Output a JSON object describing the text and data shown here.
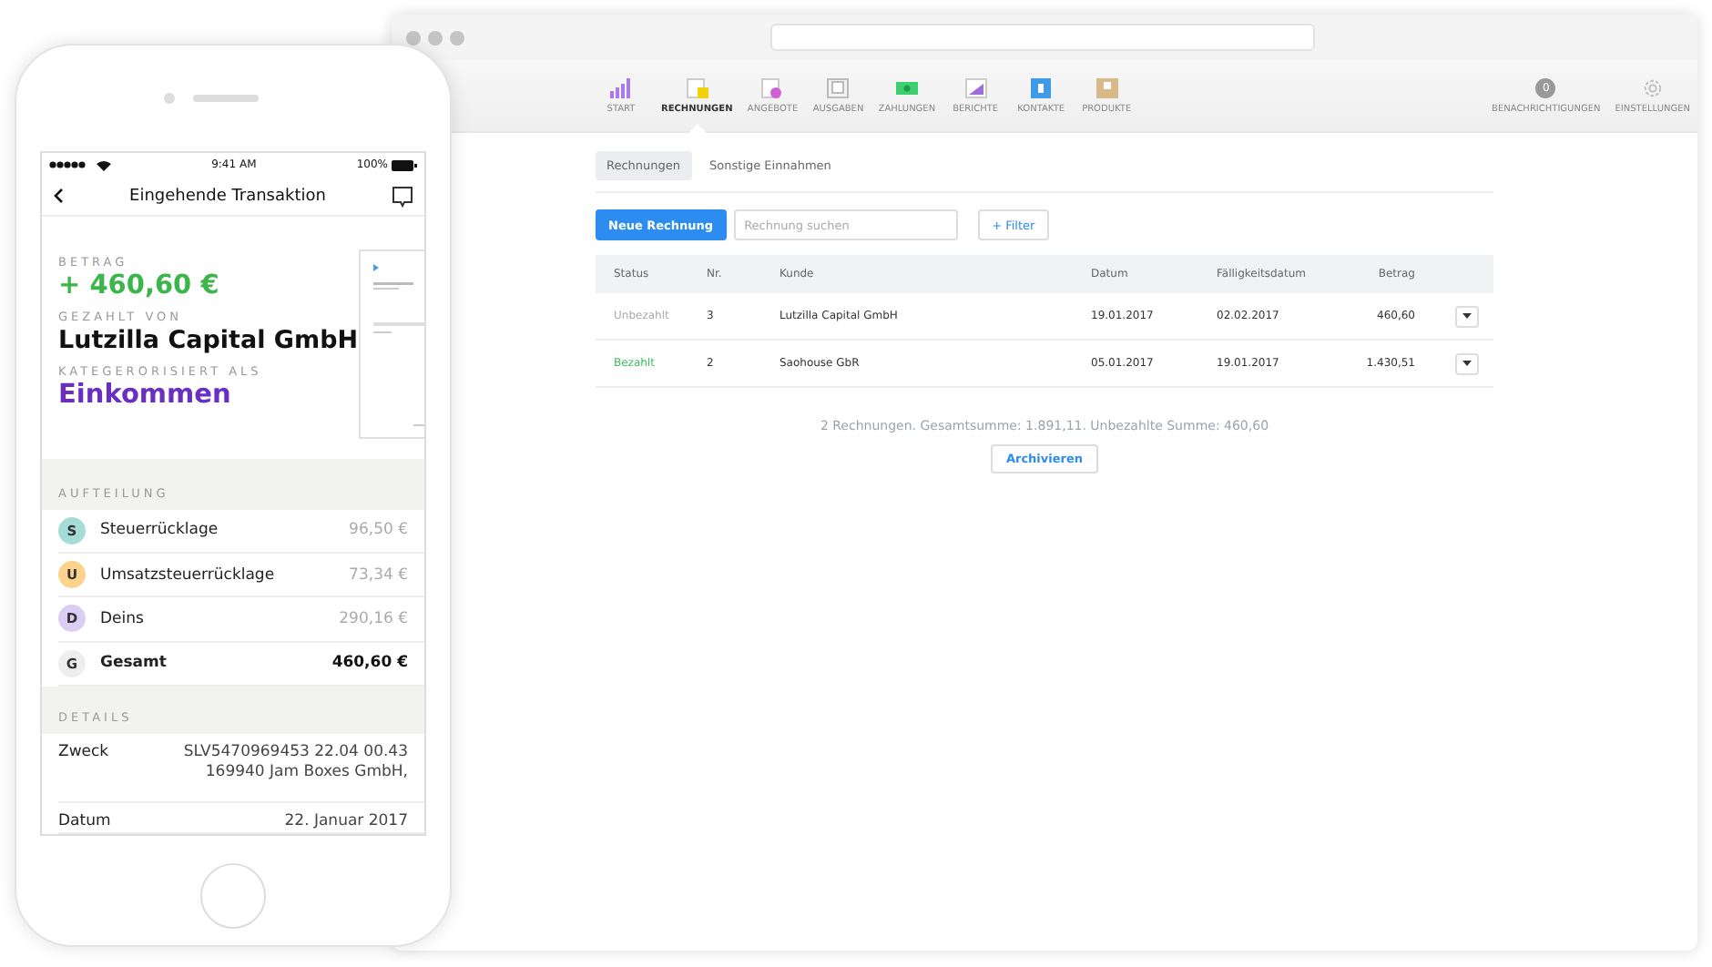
{
  "web_app": {
    "nav": {
      "items": [
        {
          "label": "START",
          "selected": false
        },
        {
          "label": "RECHNUNGEN",
          "selected": true
        },
        {
          "label": "ANGEBOTE",
          "selected": false
        },
        {
          "label": "AUSGABEN",
          "selected": false
        },
        {
          "label": "ZAHLUNGEN",
          "selected": false
        },
        {
          "label": "BERICHTE",
          "selected": false
        },
        {
          "label": "KONTAKTE",
          "selected": false
        },
        {
          "label": "PRODUKTE",
          "selected": false
        }
      ],
      "right_items": [
        {
          "label": "BENACHRICHTIGUNGEN",
          "badge": "0"
        },
        {
          "label": "EINSTELLUNGEN"
        }
      ]
    },
    "subtabs": [
      {
        "label": "Rechnungen",
        "selected": true
      },
      {
        "label": "Sonstige Einnahmen",
        "selected": false
      }
    ],
    "toolbar": {
      "new_button": "Neue Rechnung",
      "search": {
        "placeholder": "Rechnung suchen"
      },
      "filter_button": "+ Filter"
    },
    "table": {
      "columns": [
        "Status",
        "Nr.",
        "Kunde",
        "Datum",
        "Fälligkeitsdatum",
        "Betrag"
      ],
      "rows": [
        {
          "status": "Unbezahlt",
          "paid": false,
          "nr": "3",
          "kunde": "Lutzilla Capital GmbH",
          "datum": "19.01.2017",
          "faellig": "02.02.2017",
          "betrag": "460,60"
        },
        {
          "status": "Bezahlt",
          "paid": true,
          "nr": "2",
          "kunde": "Saohouse GbR",
          "datum": "05.01.2017",
          "faellig": "19.01.2017",
          "betrag": "1.430,51"
        }
      ]
    },
    "summary": "2 Rechnungen. Gesamtsumme: 1.891,11. Unbezahlte Summe: 460,60",
    "archive_button": "Archivieren"
  },
  "phone": {
    "status_bar": {
      "time": "9:41 AM",
      "battery": "100%"
    },
    "title": "Eingehende Transaktion",
    "amount_label": "BETRAG",
    "amount": "+ 460,60 €",
    "payer_label": "GEZAHLT VON",
    "payer": "Lutzilla Capital GmbH",
    "category_label": "KATEGERORISIERT ALS",
    "category": "Einkommen",
    "split": {
      "title": "AUFTEILUNG",
      "rows": [
        {
          "kind": "part",
          "letter": "S",
          "color": "#a6dcd6",
          "name": "Steuerrücklage",
          "amount": "96,50 €"
        },
        {
          "kind": "part",
          "letter": "U",
          "color": "#fcd38c",
          "name": "Umsatzsteuerrücklage",
          "amount": "73,34 €"
        },
        {
          "kind": "part",
          "letter": "D",
          "color": "#dccdf5",
          "name": "Deins",
          "amount": "290,16 €"
        },
        {
          "kind": "total",
          "letter": "G",
          "color": "#eeeeee",
          "name": "Gesamt",
          "amount": "460,60 €"
        }
      ]
    },
    "details": {
      "title": "DETAILS",
      "rows": [
        {
          "label": "Zweck",
          "value": "SLV5470969453 22.04 00.43 169940 Jam Boxes GmbH,"
        },
        {
          "label": "Datum",
          "value": "22. Januar 2017"
        }
      ]
    }
  }
}
